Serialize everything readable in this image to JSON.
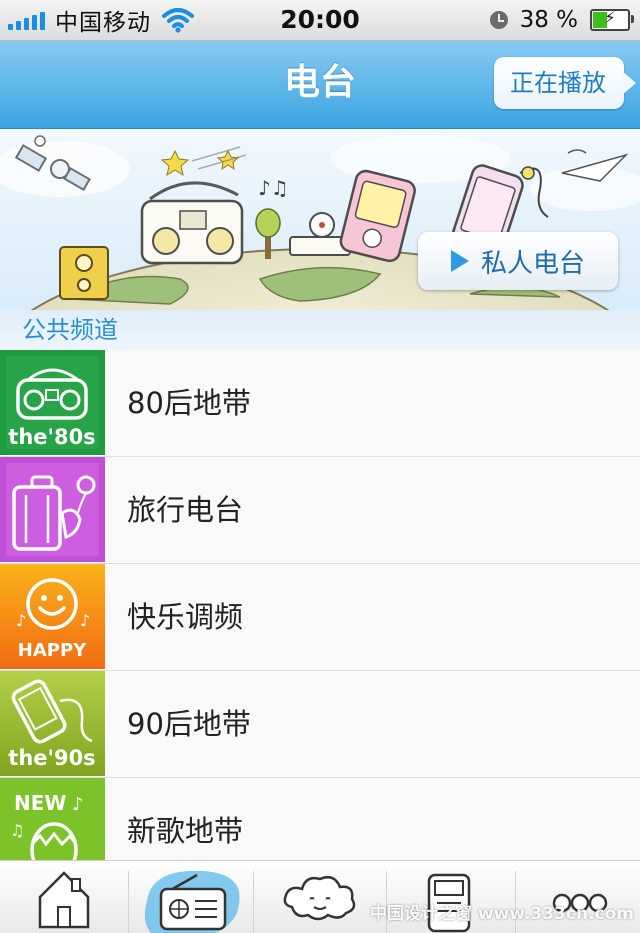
{
  "status_bar": {
    "carrier": "中国移动",
    "time": "20:00",
    "battery_percent": "38 %",
    "battery_level": 0.38,
    "icons": [
      "signal-icon",
      "wifi-icon",
      "alarm-clock-icon",
      "battery-icon"
    ]
  },
  "nav": {
    "title": "电台",
    "now_playing_label": "正在播放"
  },
  "banner": {
    "private_radio_label": "私人电台"
  },
  "section": {
    "title": "公共频道"
  },
  "channels": [
    {
      "name": "80后地带",
      "thumb_text": "the'80s",
      "color": "#1e9a3f",
      "icon": "boombox-icon"
    },
    {
      "name": "旅行电台",
      "thumb_text": "",
      "color": "#c04fd8",
      "icon": "suitcase-icon"
    },
    {
      "name": "快乐调频",
      "thumb_text": "HAPPY",
      "color": "#f48a16",
      "icon": "smiley-icon"
    },
    {
      "name": "90后地带",
      "thumb_text": "the'90s",
      "color": "#8fb628",
      "icon": "phone-icon"
    },
    {
      "name": "新歌地带",
      "thumb_text": "NEW",
      "color": "#7cc229",
      "icon": "egg-icon"
    }
  ],
  "tabs": [
    {
      "id": "home",
      "icon": "house-icon"
    },
    {
      "id": "radio",
      "icon": "radio-icon",
      "selected": true
    },
    {
      "id": "mine",
      "icon": "cloud-icon"
    },
    {
      "id": "downloads",
      "icon": "device-icon"
    },
    {
      "id": "more",
      "icon": "more-dots-icon"
    }
  ],
  "watermark": "中国设计之窗 www.333cn.com",
  "colors": {
    "accent": "#3ba4e1",
    "section_title": "#2b8fd3",
    "button_text": "#1d7dc4"
  }
}
